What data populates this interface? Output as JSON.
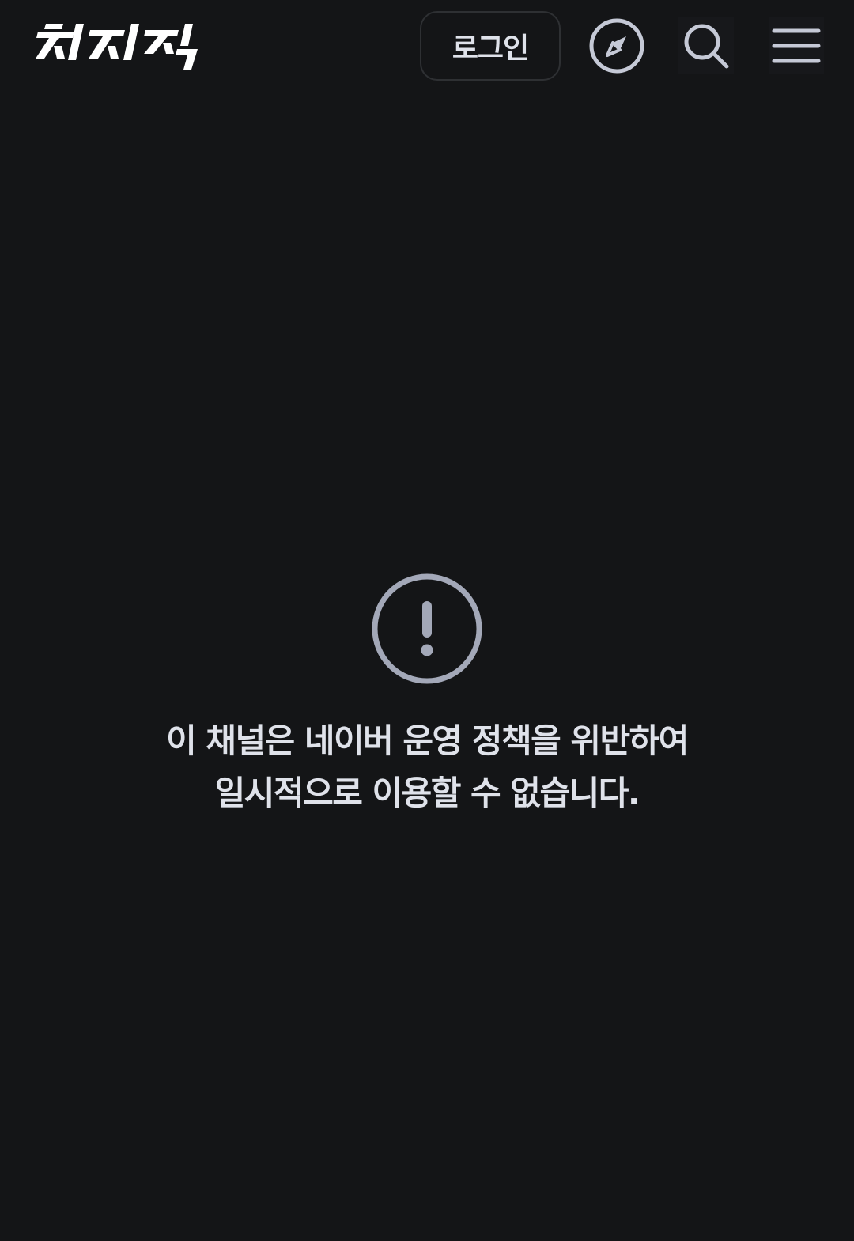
{
  "header": {
    "logo_text": "치지직",
    "login_label": "로그인",
    "icons": {
      "explore": "compass-icon",
      "search": "search-icon",
      "menu": "hamburger-menu-icon"
    }
  },
  "notice": {
    "icon": "exclamation-circle-icon",
    "message_line1": "이 채널은 네이버 운영 정책을 위반하여",
    "message_line2": "일시적으로 이용할 수 없습니다."
  },
  "colors": {
    "background": "#141517",
    "text": "#dfe2ea",
    "icon_gray": "#a3a8b8",
    "border": "#2e3033"
  }
}
